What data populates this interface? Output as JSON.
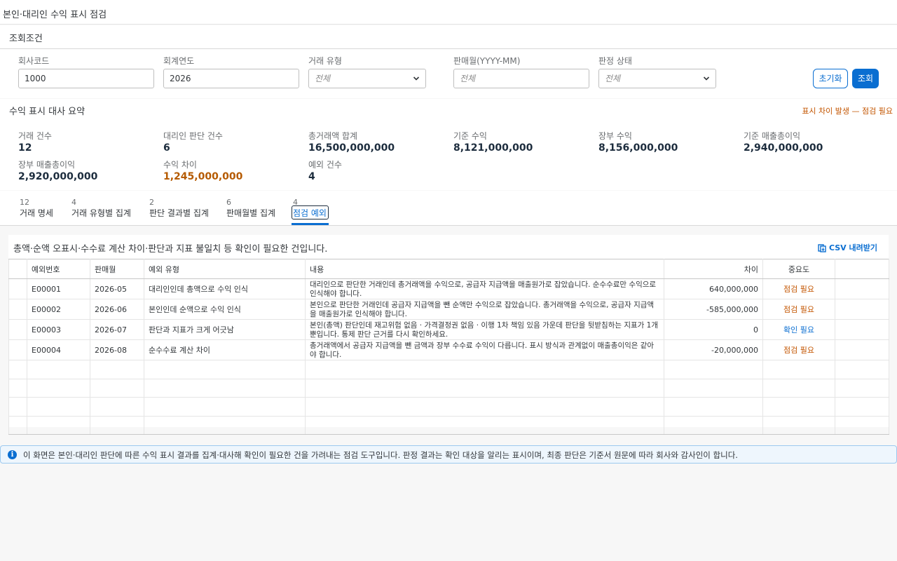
{
  "page": {
    "title": "본인·대리인 수익 표시 점검"
  },
  "filters": {
    "title": "조회조건",
    "company_code": {
      "label": "회사코드",
      "value": "1000"
    },
    "fiscal_year": {
      "label": "회계연도",
      "value": "2026"
    },
    "deal_type": {
      "label": "거래 유형",
      "value": "전체"
    },
    "sale_month": {
      "label": "판매월(YYYY-MM)",
      "placeholder": "전체"
    },
    "verdict_status": {
      "label": "판정 상태",
      "value": "전체"
    },
    "reset_label": "초기화",
    "search_label": "조회"
  },
  "summary": {
    "title": "수익 표시 대사 요약",
    "warning": "표시 차이 발생 — 점검 필요",
    "kpis": [
      {
        "label": "거래 건수",
        "value": "12"
      },
      {
        "label": "대리인 판단 건수",
        "value": "6"
      },
      {
        "label": "총거래액 합계",
        "value": "16,500,000,000"
      },
      {
        "label": "기준 수익",
        "value": "8,121,000,000"
      },
      {
        "label": "장부 수익",
        "value": "8,156,000,000"
      },
      {
        "label": "기준 매출총이익",
        "value": "2,940,000,000"
      },
      {
        "label": "장부 매출총이익",
        "value": "2,920,000,000"
      },
      {
        "label": "수익 차이",
        "value": "1,245,000,000"
      },
      {
        "label": "예외 건수",
        "value": "4"
      }
    ]
  },
  "tabs": [
    {
      "count": "12",
      "label": "거래 명세"
    },
    {
      "count": "4",
      "label": "거래 유형별 집계"
    },
    {
      "count": "2",
      "label": "판단 결과별 집계"
    },
    {
      "count": "6",
      "label": "판매월별 집계"
    },
    {
      "count": "4",
      "label": "점검 예외"
    }
  ],
  "exceptions": {
    "title": "총액·순액 오표시·수수료 계산 차이·판단과 지표 불일치 등 확인이 필요한 건입니다.",
    "csv_label": "CSV 내려받기",
    "columns": {
      "id": "예외번호",
      "month": "판매월",
      "type": "예외 유형",
      "content": "내용",
      "diff": "차이",
      "severity": "중요도"
    },
    "rows": [
      {
        "id": "E00001",
        "month": "2026-05",
        "type": "대리인인데 총액으로 수익 인식",
        "content": "대리인으로 판단한 거래인데 총거래액을 수익으로, 공급자 지급액을 매출원가로 잡았습니다. 순수수료만 수익으로 인식해야 합니다.",
        "diff": "640,000,000",
        "severity": "점검 필요"
      },
      {
        "id": "E00002",
        "month": "2026-06",
        "type": "본인인데 순액으로 수익 인식",
        "content": "본인으로 판단한 거래인데 공급자 지급액을 뺀 순액만 수익으로 잡았습니다. 총거래액을 수익으로, 공급자 지급액을 매출원가로 인식해야 합니다.",
        "diff": "-585,000,000",
        "severity": "점검 필요"
      },
      {
        "id": "E00003",
        "month": "2026-07",
        "type": "판단과 지표가 크게 어긋남",
        "content": "본인(총액) 판단인데 재고위험 없음 · 가격결정권 없음 · 이행 1차 책임 있음 가운데 판단을 뒷받침하는 지표가 1개뿐입니다. 통제 판단 근거를 다시 확인하세요.",
        "diff": "0",
        "severity": "확인 필요"
      },
      {
        "id": "E00004",
        "month": "2026-08",
        "type": "순수수료 계산 차이",
        "content": "총거래액에서 공급자 지급액을 뺀 금액과 장부 수수료 수익이 다릅니다. 표시 방식과 관계없이 매출총이익은 같아야 합니다.",
        "diff": "-20,000,000",
        "severity": "점검 필요"
      }
    ]
  },
  "info": {
    "text": "이 화면은 본인·대리인 판단에 따른 수익 표시 결과를 집계·대사해 확인이 필요한 건을 가려내는 점검 도구입니다. 판정 결과는 확인 대상을 알리는 표시이며, 최종 판단은 기준서 원문에 따라 회사와 감사인이 합니다."
  }
}
